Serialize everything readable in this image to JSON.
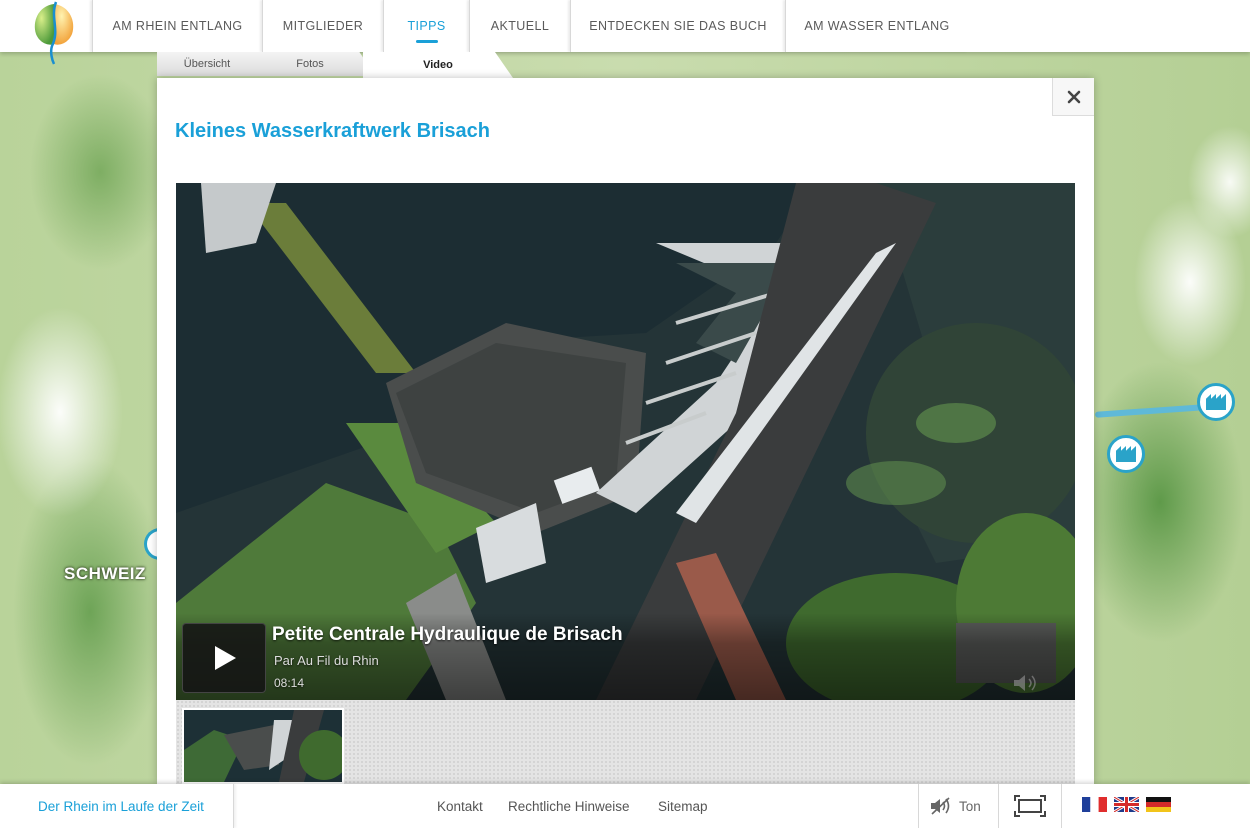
{
  "nav": {
    "items": [
      {
        "label": "AM RHEIN ENTLANG"
      },
      {
        "label": "MITGLIEDER"
      },
      {
        "label": "TIPPS"
      },
      {
        "label": "AKTUELL"
      },
      {
        "label": "ENTDECKEN SIE DAS BUCH"
      },
      {
        "label": "AM WASSER ENTLANG"
      }
    ],
    "active": "TIPPS"
  },
  "subtabs": [
    {
      "label": "Übersicht"
    },
    {
      "label": "Fotos"
    },
    {
      "label": "Video"
    }
  ],
  "panel": {
    "title": "Kleines Wasserkraftwerk Brisach",
    "close_icon": "close-icon"
  },
  "video": {
    "title": "Petite Centrale Hydraulique de Brisach",
    "author": "Par Au Fil du Rhin",
    "duration": "08:14"
  },
  "map": {
    "label": "SCHWEIZ"
  },
  "footer": {
    "home_link": "Der Rhein im Laufe der Zeit",
    "links": [
      {
        "label": "Kontakt"
      },
      {
        "label": "Rechtliche Hinweise"
      },
      {
        "label": "Sitemap"
      }
    ],
    "sound_label": "Ton",
    "languages": [
      "fr",
      "en",
      "de"
    ]
  },
  "colors": {
    "accent": "#1aa0d8",
    "marker": "#2aa3c9"
  }
}
